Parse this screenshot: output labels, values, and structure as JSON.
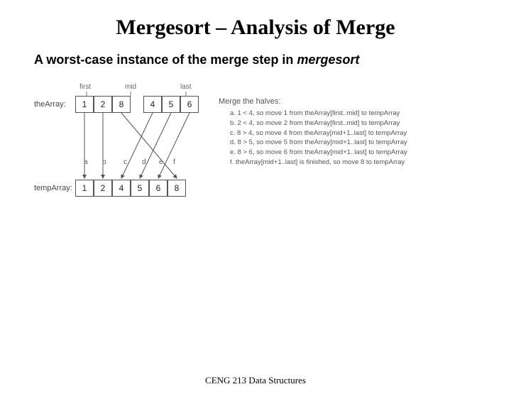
{
  "title": "Mergesort – Analysis of Merge",
  "subtitle_plain": "A worst-case instance of the merge step in ",
  "subtitle_ital": "mergesort",
  "labels": {
    "first": "first",
    "mid": "mid",
    "last": "last",
    "theArray": "theArray:",
    "tempArray": "tempArray:",
    "mergeTitle": "Merge the halves:"
  },
  "theArray": [
    "1",
    "2",
    "8",
    "4",
    "5",
    "6"
  ],
  "tempArray": [
    "1",
    "2",
    "4",
    "5",
    "6",
    "8"
  ],
  "stepLabels": [
    "a",
    "b",
    "c",
    "d",
    "e",
    "f"
  ],
  "steps": [
    "a. 1 < 4, so move 1 from theArray[first..mid] to tempArray",
    "b. 2 < 4, so move 2 from theArray[first..mid] to tempArray",
    "c. 8 > 4, so move 4 from theArray[mid+1..last] to tempArray",
    "d. 8 > 5, so move 5 from theArray[mid+1..last] to tempArray",
    "e. 8 > 6, so move 6 from theArray[mid+1..last] to tempArray",
    "f. theArray[mid+1..last] is finished, so move 8 to tempArray"
  ],
  "footer": "CENG 213 Data Structures"
}
